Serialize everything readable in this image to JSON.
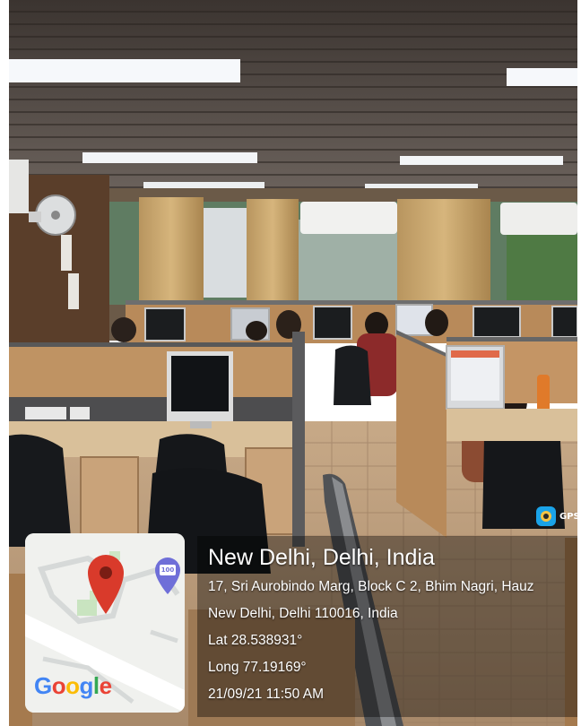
{
  "overlay": {
    "gps_label": "GPS",
    "map_logo": "Google",
    "map_badge": "100",
    "title": "New Delhi, Delhi, India",
    "address_line1": "17, Sri Aurobindo Marg, Block C 2, Bhim Nagri, Hauz",
    "address_line2": "New Delhi, Delhi 110016, India",
    "latitude": "Lat 28.538931°",
    "longitude": "Long 77.19169°",
    "timestamp": "21/09/21 11:50 AM"
  },
  "colors": {
    "google_blue": "#4285f4",
    "google_red": "#ea4335",
    "google_yellow": "#fbbc05",
    "google_green": "#34a853",
    "map_pin": "#d93a2b",
    "map_badge": "#6f6fd8",
    "gps_icon": "#1aa3e8"
  },
  "icons": [
    "map-pin-icon",
    "map-badge-icon",
    "gps-camera-icon"
  ]
}
